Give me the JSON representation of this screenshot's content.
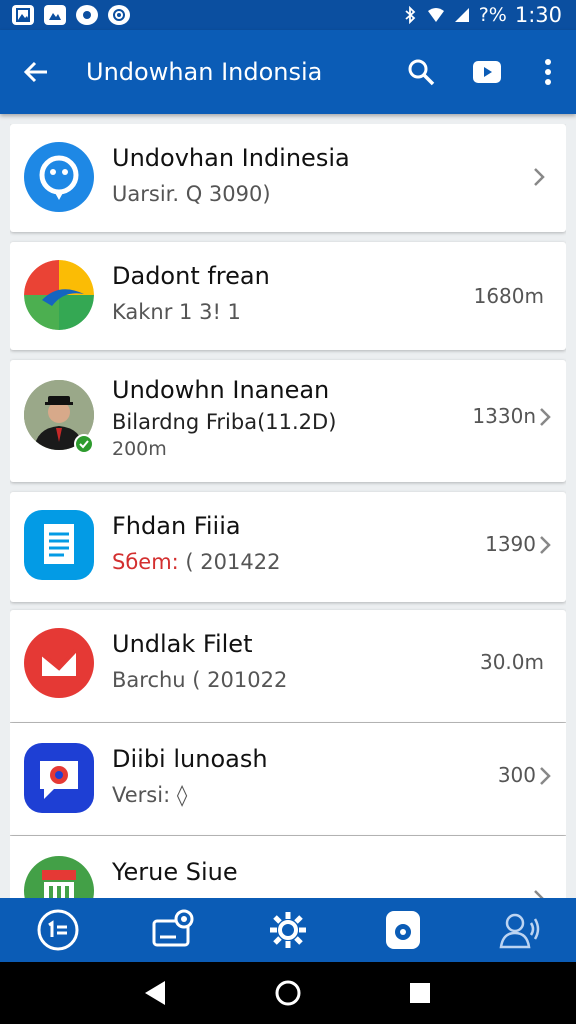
{
  "status_bar": {
    "battery_percent": "?%",
    "time": "1:30",
    "notification_icons": [
      "image-icon",
      "photo-icon",
      "chat-icon",
      "vpn-icon"
    ]
  },
  "app_bar": {
    "title": "Undowhan Indonsia",
    "back_icon": "arrow-left-icon",
    "actions": [
      "search-icon",
      "play-icon",
      "more-vert-icon"
    ]
  },
  "items": [
    {
      "name": "Undovhan Indinesia",
      "subtitle": "Uarsir. Q 3090)",
      "size": "",
      "icon": "chat-bubble-icon",
      "icon_color": "#1e88e5",
      "chevron": true
    },
    {
      "name": "Dadont frean",
      "subtitle": "Kaknr 1 3! 1",
      "size": "1680m",
      "icon": "google-logo-icon",
      "icon_color": "#fbbc05",
      "chevron": false
    },
    {
      "name": "Undowhn Inanean",
      "subtitle": "Bilardng Friba(11.2D)",
      "extra": "200m",
      "size": "1330n",
      "icon": "person-avatar-icon",
      "icon_color": "#5d4037",
      "chevron": true
    },
    {
      "name": "Fhdan Fiiia",
      "subtitle_red": "Sбem:",
      "subtitle": "( 201422",
      "size": "1390",
      "icon": "document-icon",
      "icon_color": "#039be5",
      "chevron": true
    },
    {
      "name": "Undlak Filet",
      "subtitle": "Barchu ( 201022",
      "size": "30.0m",
      "icon": "mail-icon",
      "icon_color": "#e53935",
      "chevron": false
    },
    {
      "name": "Diibi lunoash",
      "subtitle": "Versi: ◊",
      "size": "300",
      "icon": "chat-camera-icon",
      "icon_color": "#1e3fd4",
      "chevron": true
    },
    {
      "name": "Yerue Siue",
      "subtitle": "",
      "size": "",
      "icon": "store-icon",
      "icon_color": "#43a047",
      "chevron": true
    }
  ],
  "bottom_nav": [
    "circle-list-icon",
    "badge-icon",
    "settings-gear-icon",
    "camera-app-icon",
    "profile-voice-icon"
  ],
  "system_nav": [
    "back-triangle-icon",
    "home-circle-icon",
    "recents-square-icon"
  ],
  "colors": {
    "primary": "#0b5cb6",
    "status_bar": "#0b4fa0",
    "background": "#eceff1",
    "accent_red": "#d32f2f"
  }
}
